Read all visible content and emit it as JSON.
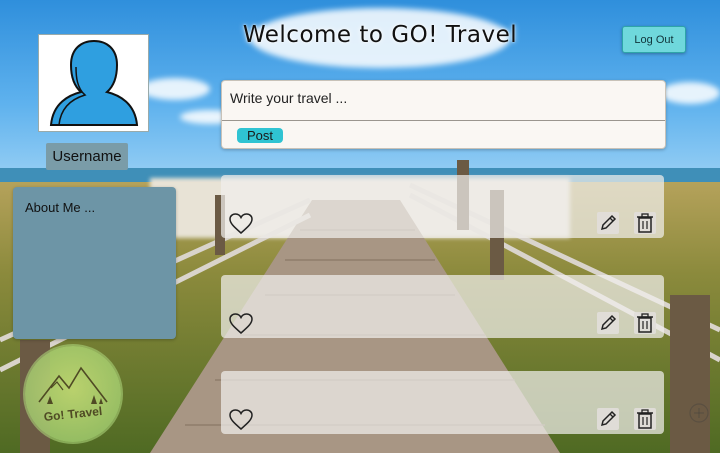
{
  "header": {
    "title": "Welcome to GO! Travel",
    "logout_label": "Log Out"
  },
  "profile": {
    "avatar_icon": "user-silhouette-icon",
    "username": "Username",
    "about_me": "About Me ..."
  },
  "composer": {
    "placeholder": "Write your travel ...",
    "post_label": "Post"
  },
  "feed": {
    "posts": [
      {
        "like_icon": "heart-icon",
        "edit_icon": "pencil-icon",
        "delete_icon": "trash-icon"
      },
      {
        "like_icon": "heart-icon",
        "edit_icon": "pencil-icon",
        "delete_icon": "trash-icon"
      },
      {
        "like_icon": "heart-icon",
        "edit_icon": "pencil-icon",
        "delete_icon": "trash-icon"
      }
    ]
  },
  "logo": {
    "text": "Go! Travel"
  },
  "colors": {
    "accent": "#2fc3d2",
    "logout_button": "#6fd8dc",
    "panel": "#6d95a6"
  }
}
